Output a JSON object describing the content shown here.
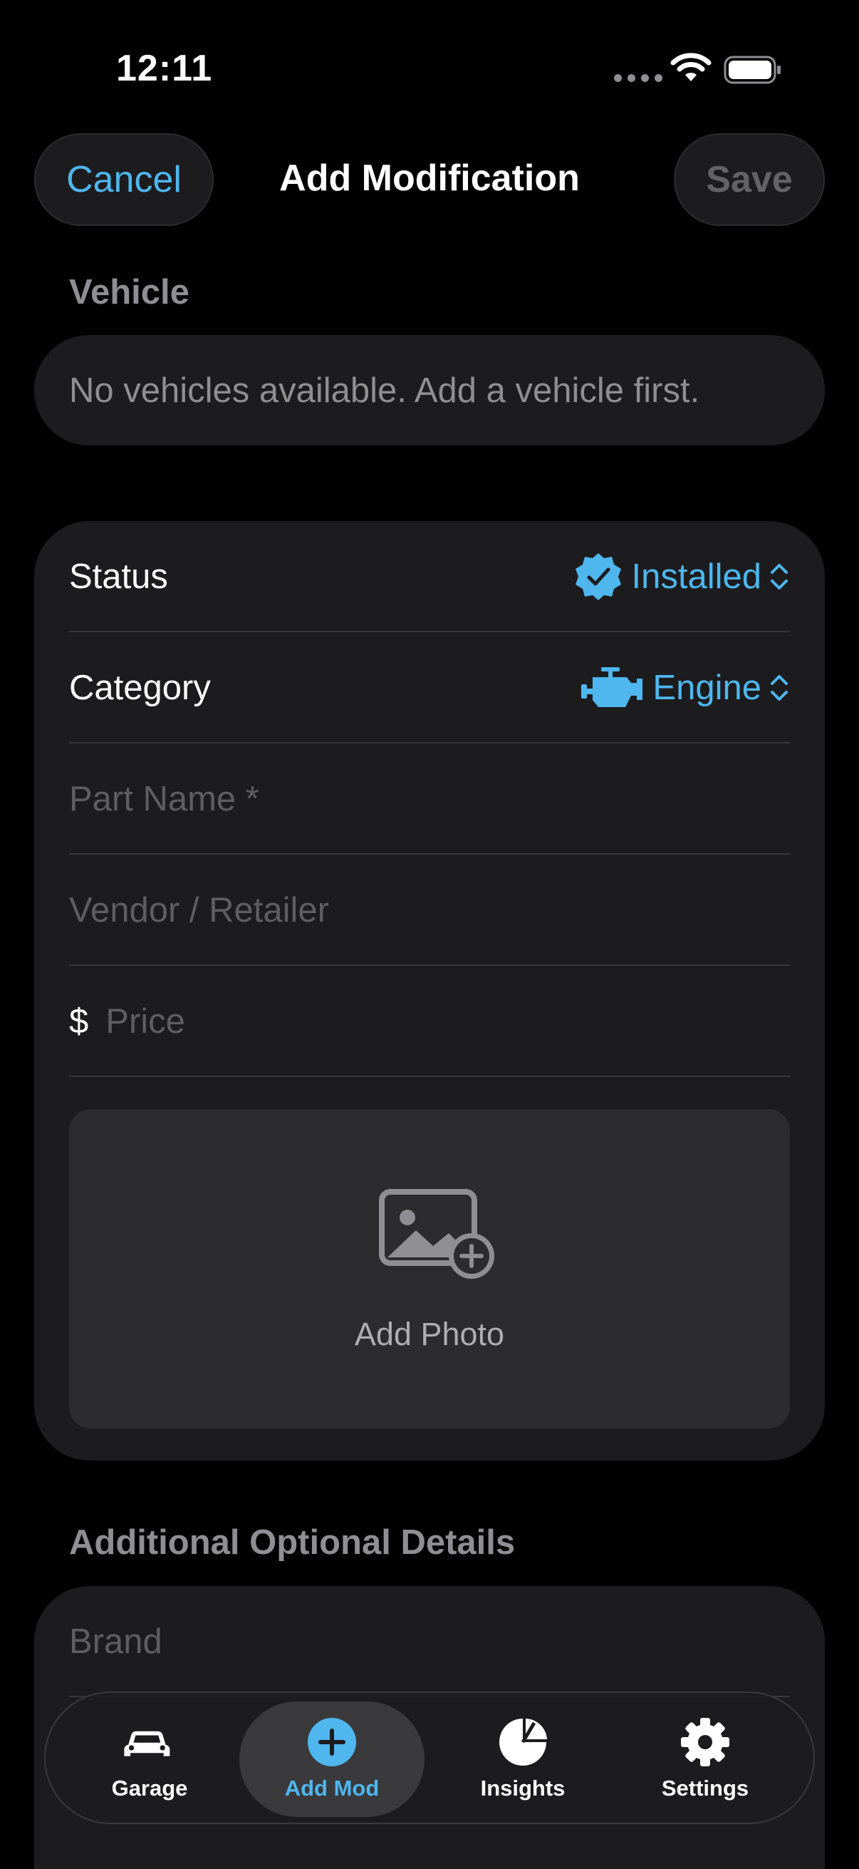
{
  "status_bar": {
    "time": "12:11"
  },
  "nav": {
    "cancel_label": "Cancel",
    "title": "Add Modification",
    "save_label": "Save"
  },
  "vehicle": {
    "section_label": "Vehicle",
    "empty_text": "No vehicles available. Add a vehicle first."
  },
  "form": {
    "status_label": "Status",
    "status_value": "Installed",
    "category_label": "Category",
    "category_value": "Engine",
    "part_name_placeholder": "Part Name *",
    "vendor_placeholder": "Vendor / Retailer",
    "currency_symbol": "$",
    "price_placeholder": "Price",
    "add_photo_label": "Add Photo"
  },
  "additional": {
    "section_label": "Additional Optional Details",
    "brand_placeholder": "Brand"
  },
  "tabs": [
    {
      "label": "Garage",
      "icon": "car-icon"
    },
    {
      "label": "Add Mod",
      "icon": "plus-circle-icon",
      "active": true
    },
    {
      "label": "Insights",
      "icon": "pie-chart-icon"
    },
    {
      "label": "Settings",
      "icon": "gear-icon"
    }
  ],
  "colors": {
    "accent": "#4fb6ee",
    "background": "#000000",
    "card": "#1c1c1e"
  }
}
